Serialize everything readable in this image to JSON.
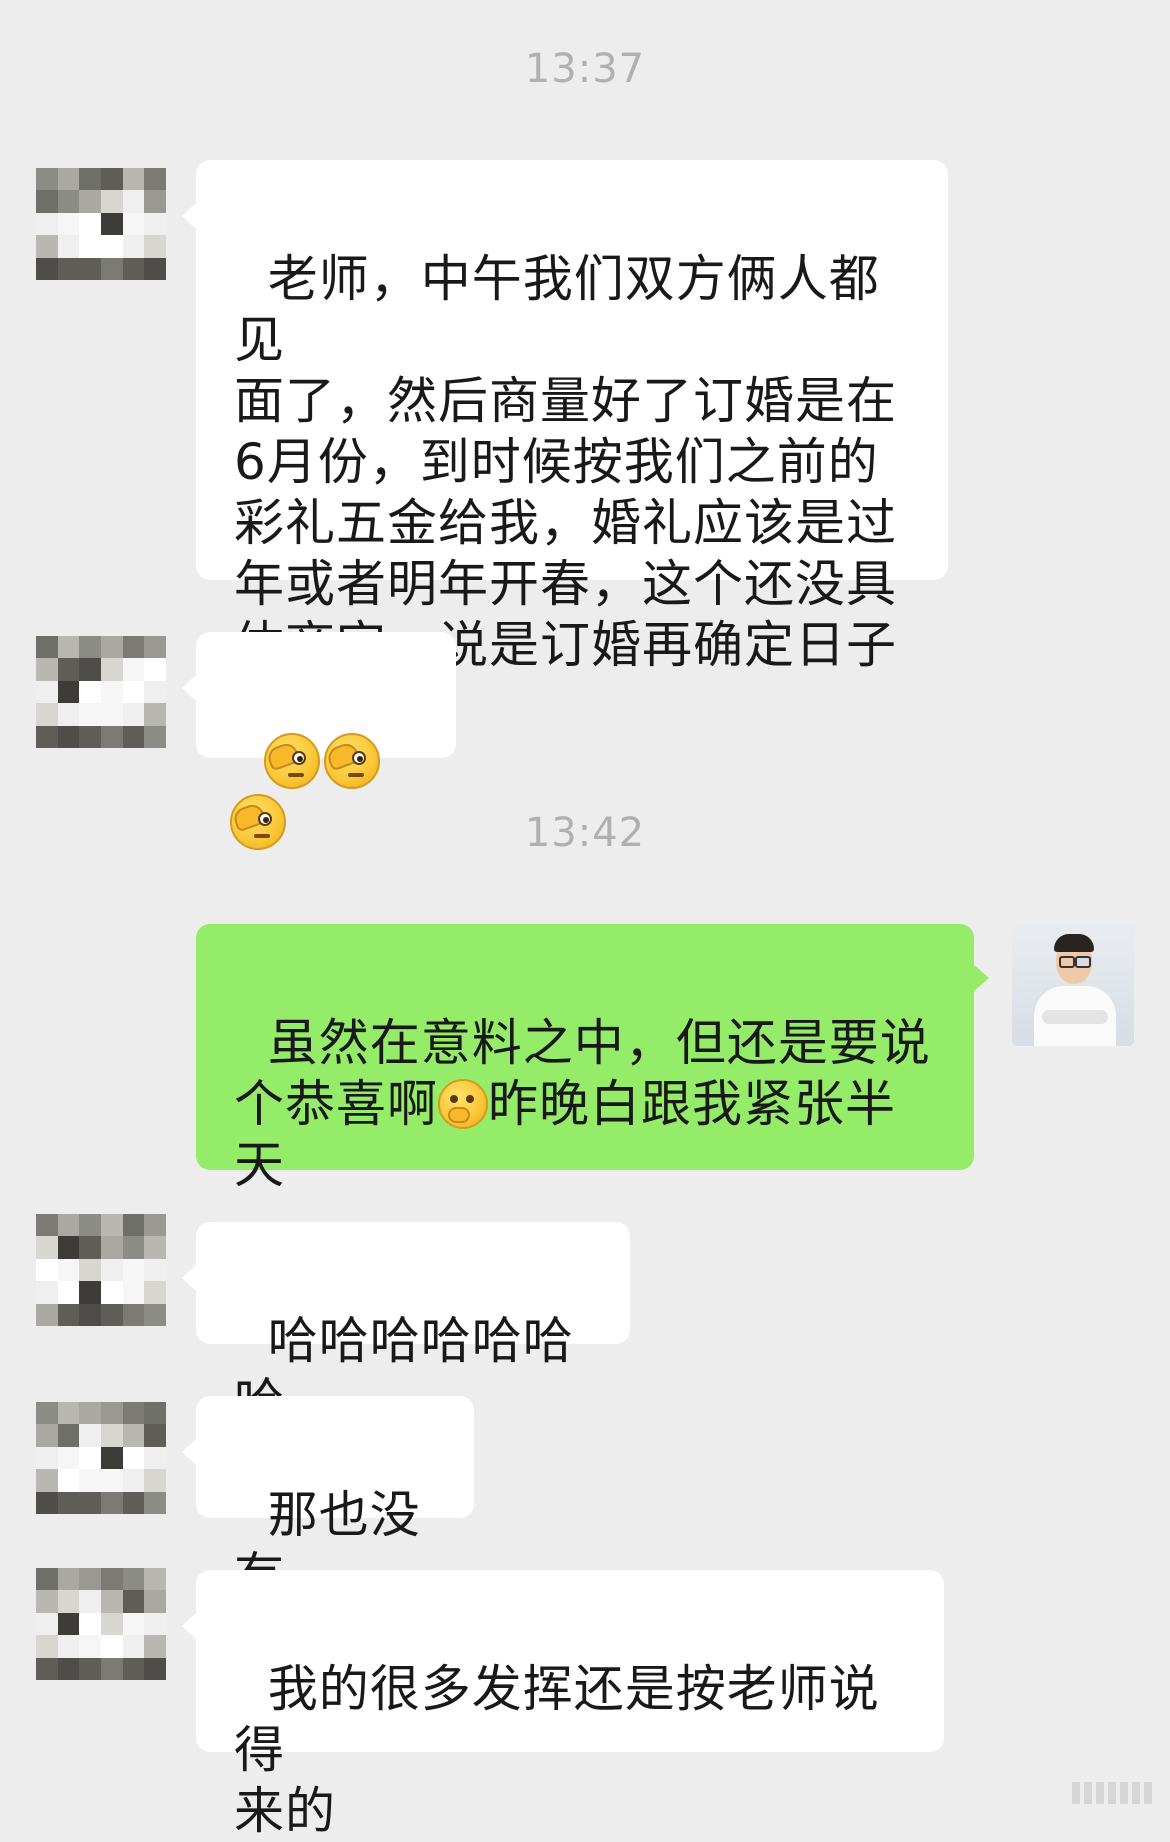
{
  "timestamps": [
    "13:37",
    "13:42"
  ],
  "messages": [
    {
      "sender": "other",
      "text": "老师，中午我们双方俩人都见\n面了，然后商量好了订婚是在\n6月份，到时候按我们之前的\n彩礼五金给我，婚礼应该是过\n年或者明年开春，这个还没具\n体商定，说是订婚再确定日子"
    },
    {
      "sender": "other",
      "emoji": "face-with-peeking-eye-emoji",
      "count": 3
    },
    {
      "sender": "me",
      "text_part1": "虽然在意料之中，但还是要说\n个恭喜啊",
      "emoji": "face-with-hand-over-mouth-emoji",
      "text_part2": "昨晚白跟我紧张半\n天"
    },
    {
      "sender": "other",
      "text": "哈哈哈哈哈哈哈"
    },
    {
      "sender": "other",
      "text": "那也没有"
    },
    {
      "sender": "other",
      "text": "我的很多发挥还是按老师说得\n来的"
    }
  ],
  "colors": {
    "background": "#ededed",
    "bubble_other": "#ffffff",
    "bubble_me": "#95ec69",
    "timestamp": "#b0b0b0"
  }
}
